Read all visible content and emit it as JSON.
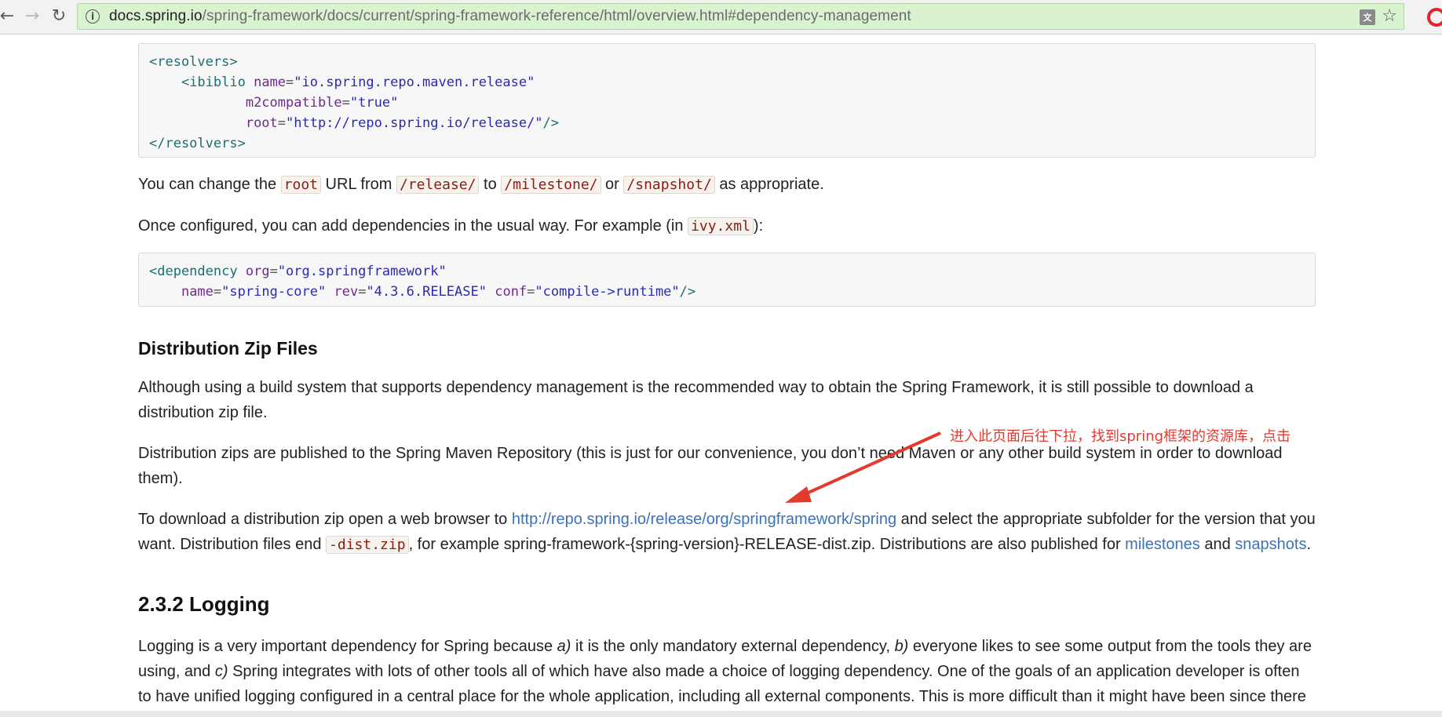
{
  "browser": {
    "url_host": "docs.spring.io",
    "url_path": "/spring-framework/docs/current/spring-framework-reference/html/overview.html#dependency-management",
    "translate_label": "文"
  },
  "code1": {
    "l1_tag": "<resolvers>",
    "l2_tag": "<ibiblio",
    "l2_attr": "name",
    "l2_val": "\"io.spring.repo.maven.release\"",
    "l3_attr": "m2compatible",
    "l3_val": "\"true\"",
    "l4_attr": "root",
    "l4_val": "\"http://repo.spring.io/release/\"",
    "l4_end": "/>",
    "l5_tag": "</resolvers>"
  },
  "para1": {
    "t1": "You can change the ",
    "c1": "root",
    "t2": " URL from ",
    "c2": "/release/",
    "t3": " to ",
    "c3": "/milestone/",
    "t4": " or ",
    "c4": "/snapshot/",
    "t5": " as appropriate."
  },
  "para2": {
    "t1": "Once configured, you can add dependencies in the usual way. For example (in ",
    "c1": "ivy.xml",
    "t2": "):"
  },
  "code2": {
    "l1_tag": "<dependency",
    "l1_attr": "org",
    "l1_val": "\"org.springframework\"",
    "l2_attr1": "name",
    "l2_val1": "\"spring-core\"",
    "l2_attr2": "rev",
    "l2_val2": "\"4.3.6.RELEASE\"",
    "l2_attr3": "conf",
    "l2_val3": "\"compile->runtime\"",
    "l2_end": "/>"
  },
  "section_dist": {
    "heading": "Distribution Zip Files",
    "p1": "Although using a build system that supports dependency management is the recommended way to obtain the Spring Framework, it is still possible to download a distribution zip file.",
    "p2": "Distribution zips are published to the Spring Maven Repository (this is just for our convenience, you don’t need Maven or any other build system in order to download them).",
    "p3_t1": "To download a distribution zip open a web browser to ",
    "p3_link": "http://repo.spring.io/release/org/springframework/spring",
    "p3_t2": " and select the appropriate subfolder for the version that you want. Distribution files end ",
    "p3_code": "-dist.zip",
    "p3_t3": ", for example spring-framework-{spring-version}-RELEASE-dist.zip. Distributions are also published for ",
    "p3_link2": "milestones",
    "p3_t4": " and ",
    "p3_link3": "snapshots",
    "p3_t5": "."
  },
  "section_logging": {
    "heading": "2.3.2 Logging",
    "p_t1": "Logging is a very important dependency for Spring because ",
    "p_em1": "a)",
    "p_t2": " it is the only mandatory external dependency, ",
    "p_em2": "b)",
    "p_t3": " everyone likes to see some output from the tools they are using, and ",
    "p_em3": "c)",
    "p_t4": " Spring integrates with lots of other tools all of which have also made a choice of logging dependency. One of the goals of an application developer is often to have unified logging configured in a central place for the whole application, including all external components. This is more difficult than it might have been since there"
  },
  "annotation": {
    "text": "进入此页面后往下拉，找到spring框架的资源库，点击",
    "color": "#e33a2e"
  }
}
